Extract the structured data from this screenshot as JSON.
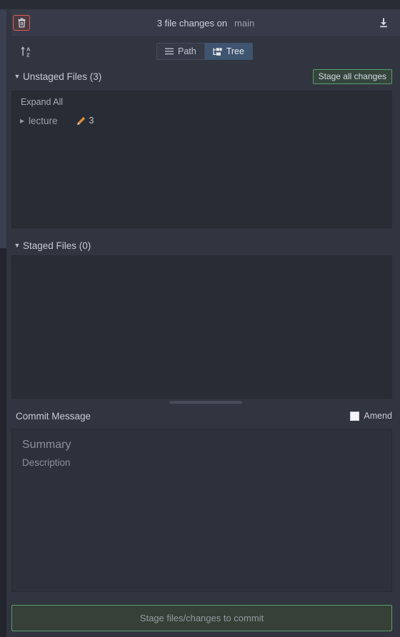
{
  "header": {
    "trash_icon": "trash-icon",
    "title": "3 file changes on",
    "branch": "main",
    "download_icon": "download-icon"
  },
  "toolbar": {
    "sort_icon": "sort-alpha-icon",
    "views": [
      {
        "label": "Path",
        "icon": "list-icon",
        "active": false
      },
      {
        "label": "Tree",
        "icon": "tree-icon",
        "active": true
      }
    ]
  },
  "unstaged": {
    "caret": "▼",
    "title": "Unstaged Files (3)",
    "stage_all_label": "Stage all changes",
    "expand_all_label": "Expand All",
    "rows": [
      {
        "caret": "▶",
        "name": "lecture",
        "status_icon": "pencil-icon",
        "count": "3"
      }
    ]
  },
  "staged": {
    "caret": "▼",
    "title": "Staged Files (0)",
    "rows": []
  },
  "commit": {
    "label": "Commit Message",
    "amend_label": "Amend",
    "amend_checked": false,
    "summary_placeholder": "Summary",
    "description_placeholder": "Description",
    "button_label": "Stage files/changes to commit"
  },
  "colors": {
    "background": "#31353f",
    "panel": "#282c35",
    "accent_green": "#5a9e6b",
    "accent_red": "#e05a5a",
    "accent_blue": "#3f546f",
    "pencil_orange": "#e08b3a"
  }
}
